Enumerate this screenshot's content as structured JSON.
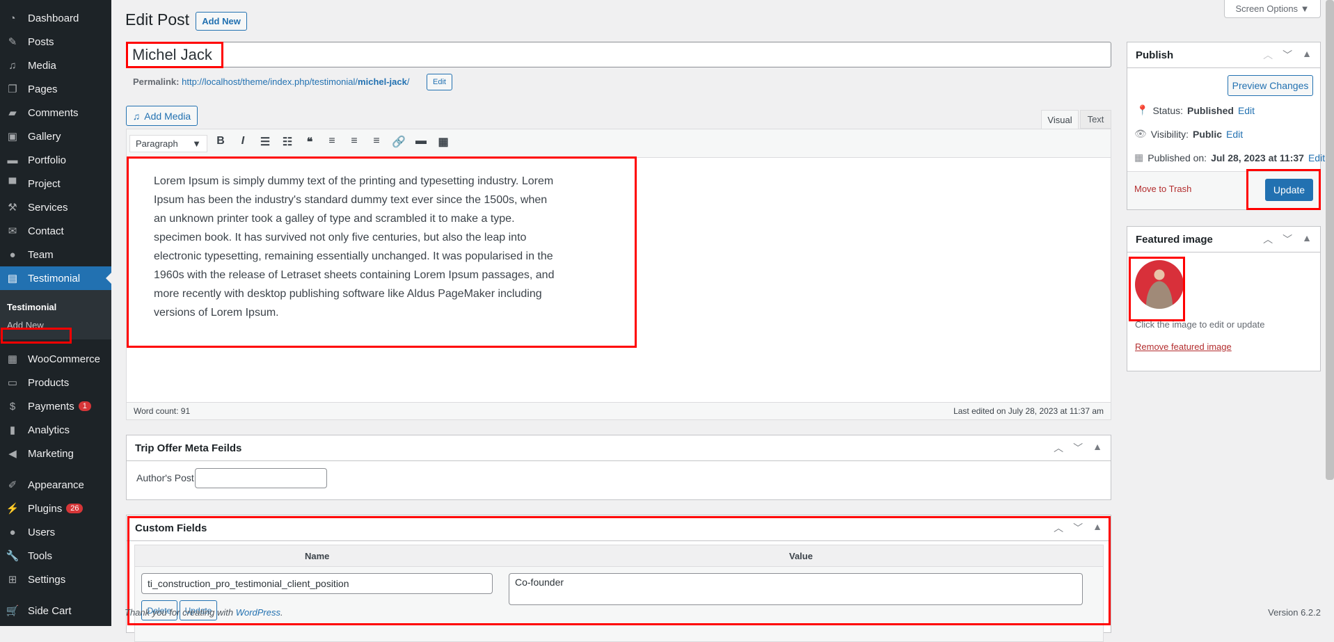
{
  "sidebar": {
    "items": [
      {
        "label": "Dashboard",
        "icon": "dashboard-icon",
        "glyph": "◔"
      },
      {
        "label": "Posts",
        "icon": "pin-icon",
        "glyph": "✎"
      },
      {
        "label": "Media",
        "icon": "media-icon",
        "glyph": "♫"
      },
      {
        "label": "Pages",
        "icon": "pages-icon",
        "glyph": "❐"
      },
      {
        "label": "Comments",
        "icon": "comment-icon",
        "glyph": "▰"
      },
      {
        "label": "Gallery",
        "icon": "gallery-icon",
        "glyph": "▣"
      },
      {
        "label": "Portfolio",
        "icon": "folder-icon",
        "glyph": "▬"
      },
      {
        "label": "Project",
        "icon": "monitor-icon",
        "glyph": "▀"
      },
      {
        "label": "Services",
        "icon": "tools-icon",
        "glyph": "⚒"
      },
      {
        "label": "Contact",
        "icon": "mail-icon",
        "glyph": "✉"
      },
      {
        "label": "Team",
        "icon": "user-icon",
        "glyph": "●"
      },
      {
        "label": "Testimonial",
        "icon": "testimonial-icon",
        "glyph": "▤"
      }
    ],
    "submenu": {
      "title": "Testimonial",
      "add_new": "Add New"
    },
    "items2": [
      {
        "label": "WooCommerce",
        "icon": "woo-icon",
        "glyph": "▦"
      },
      {
        "label": "Products",
        "icon": "archive-icon",
        "glyph": "▭"
      },
      {
        "label": "Payments",
        "icon": "dollar-icon",
        "glyph": "$",
        "badge": "1"
      },
      {
        "label": "Analytics",
        "icon": "bar-chart-icon",
        "glyph": "▮"
      },
      {
        "label": "Marketing",
        "icon": "megaphone-icon",
        "glyph": "◀"
      }
    ],
    "items3": [
      {
        "label": "Appearance",
        "icon": "brush-icon",
        "glyph": "✐"
      },
      {
        "label": "Plugins",
        "icon": "plugin-icon",
        "glyph": "⚡",
        "badge": "26"
      },
      {
        "label": "Users",
        "icon": "users-icon",
        "glyph": "●"
      },
      {
        "label": "Tools",
        "icon": "wrench-icon",
        "glyph": "🔧"
      },
      {
        "label": "Settings",
        "icon": "settings-icon",
        "glyph": "⊞"
      }
    ],
    "items4": [
      {
        "label": "Side Cart",
        "icon": "cart-icon",
        "glyph": "🛒"
      }
    ]
  },
  "header": {
    "title": "Edit Post",
    "add_new": "Add New",
    "screen_options": "Screen Options ▼"
  },
  "post": {
    "title": "Michel Jack",
    "permalink_label": "Permalink:",
    "permalink_base": "http://localhost/theme/index.php/testimonial/",
    "permalink_slug": "michel-jack",
    "permalink_end": "/",
    "edit": "Edit"
  },
  "editor": {
    "add_media": "Add Media",
    "tab_visual": "Visual",
    "tab_text": "Text",
    "format": "Paragraph",
    "toolbar": [
      {
        "icon": "bold-icon",
        "g": "B"
      },
      {
        "icon": "italic-icon",
        "g": "I"
      },
      {
        "icon": "bullet-list-icon",
        "g": "☰"
      },
      {
        "icon": "numbered-list-icon",
        "g": "☷"
      },
      {
        "icon": "blockquote-icon",
        "g": "❝"
      },
      {
        "icon": "align-left-icon",
        "g": "≡"
      },
      {
        "icon": "align-center-icon",
        "g": "≡"
      },
      {
        "icon": "align-right-icon",
        "g": "≡"
      },
      {
        "icon": "link-icon",
        "g": "🔗"
      },
      {
        "icon": "read-more-icon",
        "g": "▬"
      },
      {
        "icon": "toolbar-toggle-icon",
        "g": "▦"
      }
    ],
    "lines": [
      "Lorem Ipsum is simply dummy text of the printing and typesetting industry. Lorem",
      "Ipsum has been the industry's standard dummy text ever since the 1500s, when",
      "an unknown printer took a galley of type and scrambled it to make a type.",
      "specimen book. It has survived not only five centuries, but also the leap into",
      "electronic typesetting, remaining essentially unchanged. It was popularised in the",
      "1960s with the release of Letraset sheets containing Lorem Ipsum passages, and",
      "more recently with desktop publishing software like Aldus PageMaker including",
      "versions of Lorem Ipsum."
    ],
    "word_count": "Word count: 91",
    "last_edited": "Last edited on July 28, 2023 at 11:37 am"
  },
  "trip": {
    "title": "Trip Offer Meta Feilds",
    "label": "Author's Post",
    "value": ""
  },
  "custom": {
    "title": "Custom Fields",
    "col_name": "Name",
    "col_value": "Value",
    "name": "ti_construction_pro_testimonial_client_position",
    "value": "Co-founder",
    "delete": "Delete",
    "update": "Update"
  },
  "publish": {
    "title": "Publish",
    "preview": "Preview Changes",
    "status_label": "Status:",
    "status": "Published",
    "visibility_label": "Visibility:",
    "visibility": "Public",
    "published_label": "Published on:",
    "published": "Jul 28, 2023 at 11:37",
    "edit": "Edit",
    "trash": "Move to Trash",
    "update": "Update"
  },
  "featured": {
    "title": "Featured image",
    "hint": "Click the image to edit or update",
    "remove": "Remove featured image"
  },
  "footer": {
    "thanks": "Thank you for creating with ",
    "wp": "WordPress",
    "dot": ".",
    "version": "Version 6.2.2"
  },
  "colors": {
    "accent": "#2271b1",
    "sidebar": "#1d2327",
    "highlight": "#ff0000",
    "danger": "#b32d2e"
  }
}
